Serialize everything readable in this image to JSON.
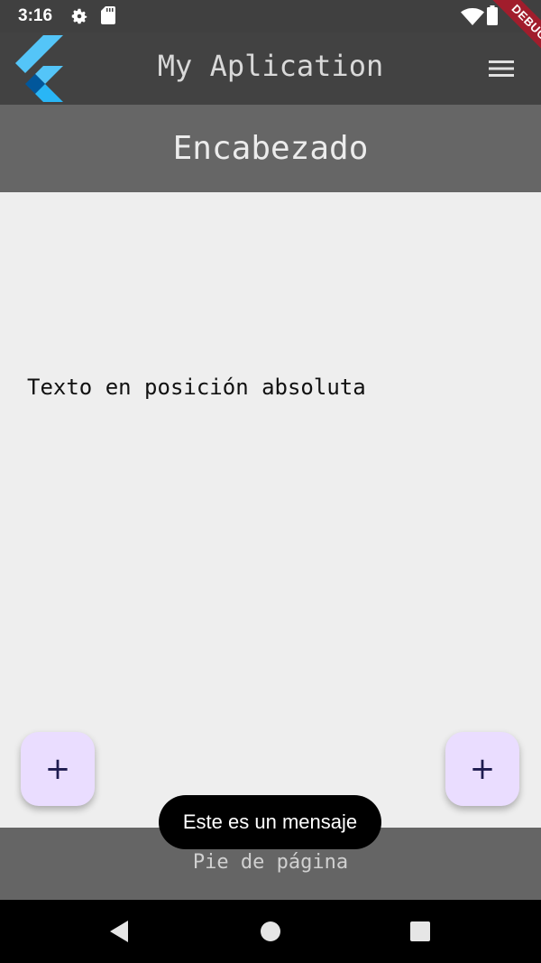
{
  "status_bar": {
    "time": "3:16",
    "icons": [
      "settings-icon",
      "sd-card-icon",
      "wifi-icon",
      "battery-icon"
    ]
  },
  "app_bar": {
    "title": "My Aplication",
    "logo": "flutter-logo",
    "menu_icon": "hamburger-menu-icon",
    "debug_banner": "DEBUG"
  },
  "header": {
    "title": "Encabezado"
  },
  "body": {
    "absolute_text": "Texto en posición absoluta"
  },
  "fabs": {
    "left_label": "+",
    "right_label": "+"
  },
  "toast": {
    "message": "Este es un mensaje"
  },
  "footer": {
    "text": "Pie de página"
  },
  "nav_bar": {
    "buttons": [
      "back-icon",
      "home-icon",
      "recents-icon"
    ]
  },
  "colors": {
    "status_bar": "#404040",
    "app_bar": "#424242",
    "header": "#666666",
    "body": "#eeeeee",
    "fab": "#eaddff",
    "footer": "#656565",
    "debug_ribbon": "#a11d2c"
  }
}
